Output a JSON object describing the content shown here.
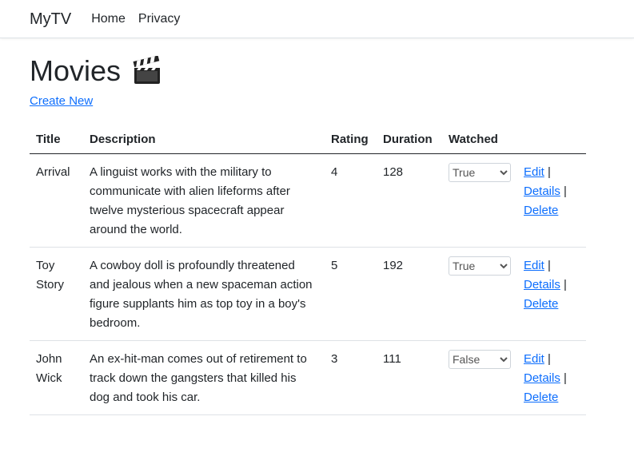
{
  "nav": {
    "brand": "MyTV",
    "links": [
      "Home",
      "Privacy"
    ]
  },
  "page": {
    "title": "Movies",
    "icon": "clapperboard-icon",
    "create_link": "Create New"
  },
  "table": {
    "headers": [
      "Title",
      "Description",
      "Rating",
      "Duration",
      "Watched"
    ],
    "actions": {
      "edit": "Edit",
      "details": "Details",
      "delete": "Delete",
      "separator": "|"
    },
    "rows": [
      {
        "title": "Arrival",
        "description": "A linguist works with the military to communicate with alien lifeforms after twelve mysterious spacecraft appear around the world.",
        "rating": "4",
        "duration": "128",
        "watched": "True"
      },
      {
        "title": "Toy Story",
        "description": "A cowboy doll is profoundly threatened and jealous when a new spaceman action figure supplants him as top toy in a boy's bedroom.",
        "rating": "5",
        "duration": "192",
        "watched": "True"
      },
      {
        "title": "John Wick",
        "description": "An ex-hit-man comes out of retirement to track down the gangsters that killed his dog and took his car.",
        "rating": "3",
        "duration": "111",
        "watched": "False"
      }
    ]
  },
  "colors": {
    "link": "#0d6efd",
    "text": "#212529"
  }
}
